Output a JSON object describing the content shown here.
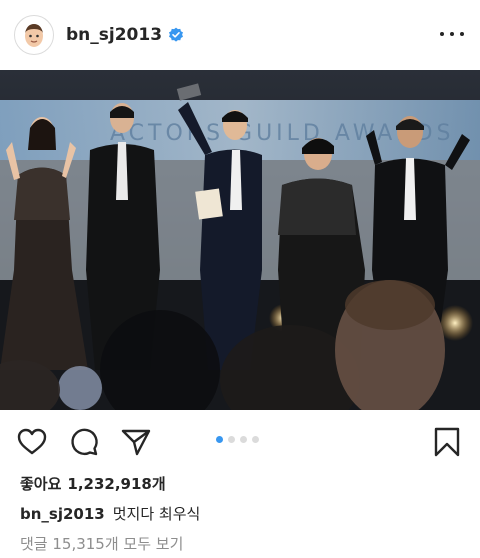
{
  "post": {
    "username": "bn_sj2013",
    "likes_label": "좋아요",
    "likes_count": "1,232,918개",
    "caption_user": "bn_sj2013",
    "caption_text": "멋지다 최우식",
    "comments_link": "댓글 15,315개 모두 보기",
    "carousel": {
      "count": 4,
      "active_index": 0
    }
  },
  "photo": {
    "banner_text": "ACTORS GUILD AWARDS"
  },
  "colors": {
    "accent": "#3897f0",
    "verified": "#3897f0",
    "muted_text": "#8e8e8e",
    "text": "#262626"
  },
  "icons": {
    "verified": "verified-badge-icon",
    "more": "more-options-icon",
    "like": "heart-icon",
    "comment": "comment-icon",
    "share": "send-icon",
    "save": "bookmark-icon"
  }
}
